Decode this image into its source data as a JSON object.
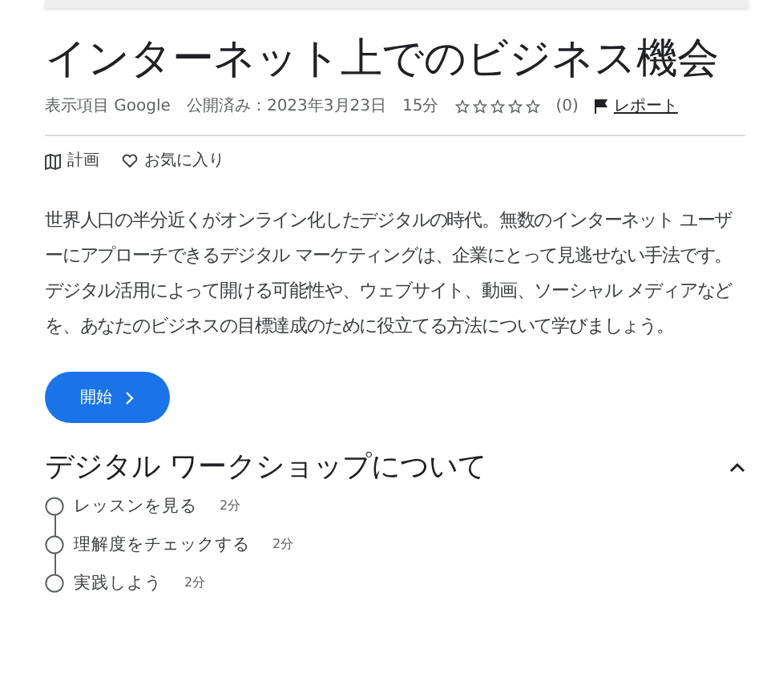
{
  "title": "インターネット上でのビジネス機会",
  "meta": {
    "provider": "表示項目 Google",
    "published": "公開済み：2023年3月23日",
    "duration": "15分",
    "stars": 0,
    "rating_count": "(0)",
    "report": "レポート"
  },
  "actions": [
    {
      "kind": "plan",
      "label": "計画"
    },
    {
      "kind": "favorite",
      "label": "お気に入り"
    }
  ],
  "description": "世界人口の半分近くがオンライン化したデジタルの時代。無数のインターネット ユーザーにアプローチできるデジタル マーケティングは、企業にとって見逃せない手法です。デジタル活用によって開ける可能性や、ウェブサイト、動画、ソーシャル メディアなどを、あなたのビジネスの目標達成のために役立てる方法について学びましょう。",
  "start_button": "開始",
  "section": {
    "title": "デジタル ワークショップについて",
    "expanded": true,
    "lessons": [
      {
        "title": "レッスンを見る",
        "duration": "2分",
        "done": false
      },
      {
        "title": "理解度をチェックする",
        "duration": "2分",
        "done": false
      },
      {
        "title": "実践しよう",
        "duration": "2分",
        "done": false
      }
    ]
  }
}
